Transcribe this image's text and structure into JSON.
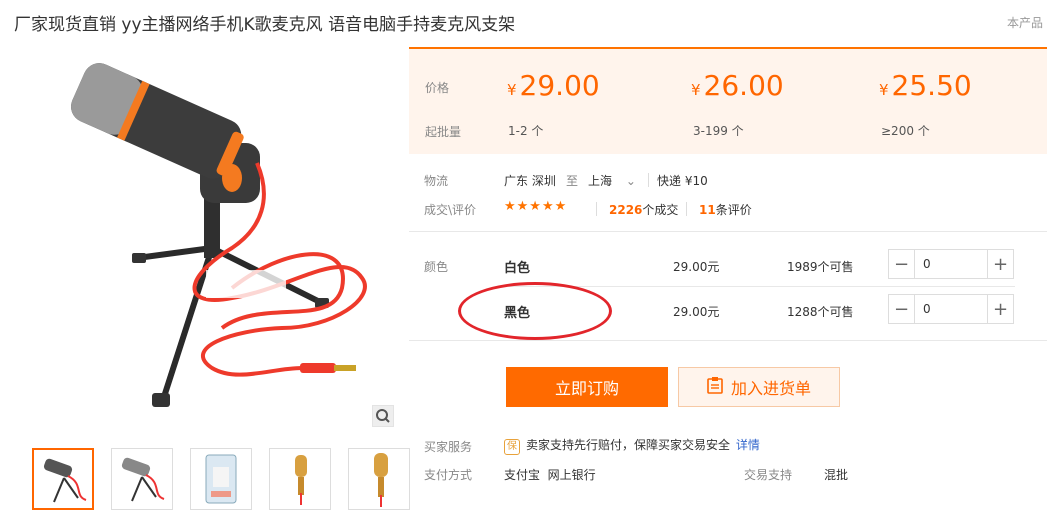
{
  "page_title": "厂家现货直销 yy主播网络手机K歌麦克风 语音电脑手持麦克风支架",
  "corner_text": "本产品",
  "price_tiers": {
    "price_label": "价格",
    "qty_label": "起批量",
    "currency": "¥",
    "tiers": [
      {
        "price": "29.00",
        "qty": "1-2 个"
      },
      {
        "price": "26.00",
        "qty": "3-199 个"
      },
      {
        "price": "25.50",
        "qty": "≥200 个"
      }
    ]
  },
  "logistics": {
    "label": "物流",
    "from": "广东 深圳",
    "to_word": "至",
    "to": "上海",
    "shipping": "快递 ¥10"
  },
  "deals": {
    "label": "成交\\评价",
    "stars": "★★★★★",
    "count": "2226",
    "count_suffix": "个成交",
    "reviews": "11",
    "reviews_suffix": "条评价"
  },
  "sku": {
    "label": "颜色",
    "rows": [
      {
        "name": "白色",
        "price": "29.00元",
        "stock": "1989个可售",
        "qty": "0"
      },
      {
        "name": "黑色",
        "price": "29.00元",
        "stock": "1288个可售",
        "qty": "0"
      }
    ],
    "minus": "−",
    "plus": "+"
  },
  "actions": {
    "buy": "立即订购",
    "cart": "加入进货单"
  },
  "service": {
    "label": "买家服务",
    "badge": "保",
    "text": "卖家支持先行赔付，保障买家交易安全",
    "detail": "详情"
  },
  "payment": {
    "label": "支付方式",
    "methods": "支付宝  网上银行",
    "trade_label": "交易支持",
    "trade_value": "混批"
  },
  "colors": {
    "accent": "#ff6a00",
    "panel": "#fff4ec",
    "annotation": "#e2252b"
  }
}
